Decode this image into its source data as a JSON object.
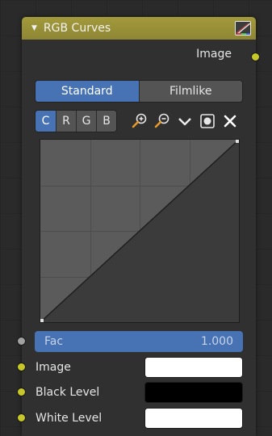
{
  "node": {
    "title": "RGB Curves",
    "output_label": "Image",
    "modes": [
      "Standard",
      "Filmlike"
    ],
    "active_mode": "Standard",
    "channels": [
      "C",
      "R",
      "G",
      "B"
    ],
    "active_channel": "C",
    "tools": [
      "zoom-in-icon",
      "zoom-out-icon",
      "chevron-down-icon",
      "clip-icon",
      "close-icon"
    ],
    "curve_points": [
      [
        0,
        0
      ],
      [
        1,
        1
      ]
    ],
    "fac": {
      "label": "Fac",
      "value": "1.000"
    },
    "inputs": [
      {
        "label": "Image",
        "color": "#ffffff"
      },
      {
        "label": "Black Level",
        "color": "#000000"
      },
      {
        "label": "White Level",
        "color": "#ffffff"
      }
    ]
  },
  "colors": {
    "header": "#9a923a",
    "accent": "#4772b3",
    "socket_color": "#c7c729",
    "socket_float": "#a1a1a1"
  }
}
